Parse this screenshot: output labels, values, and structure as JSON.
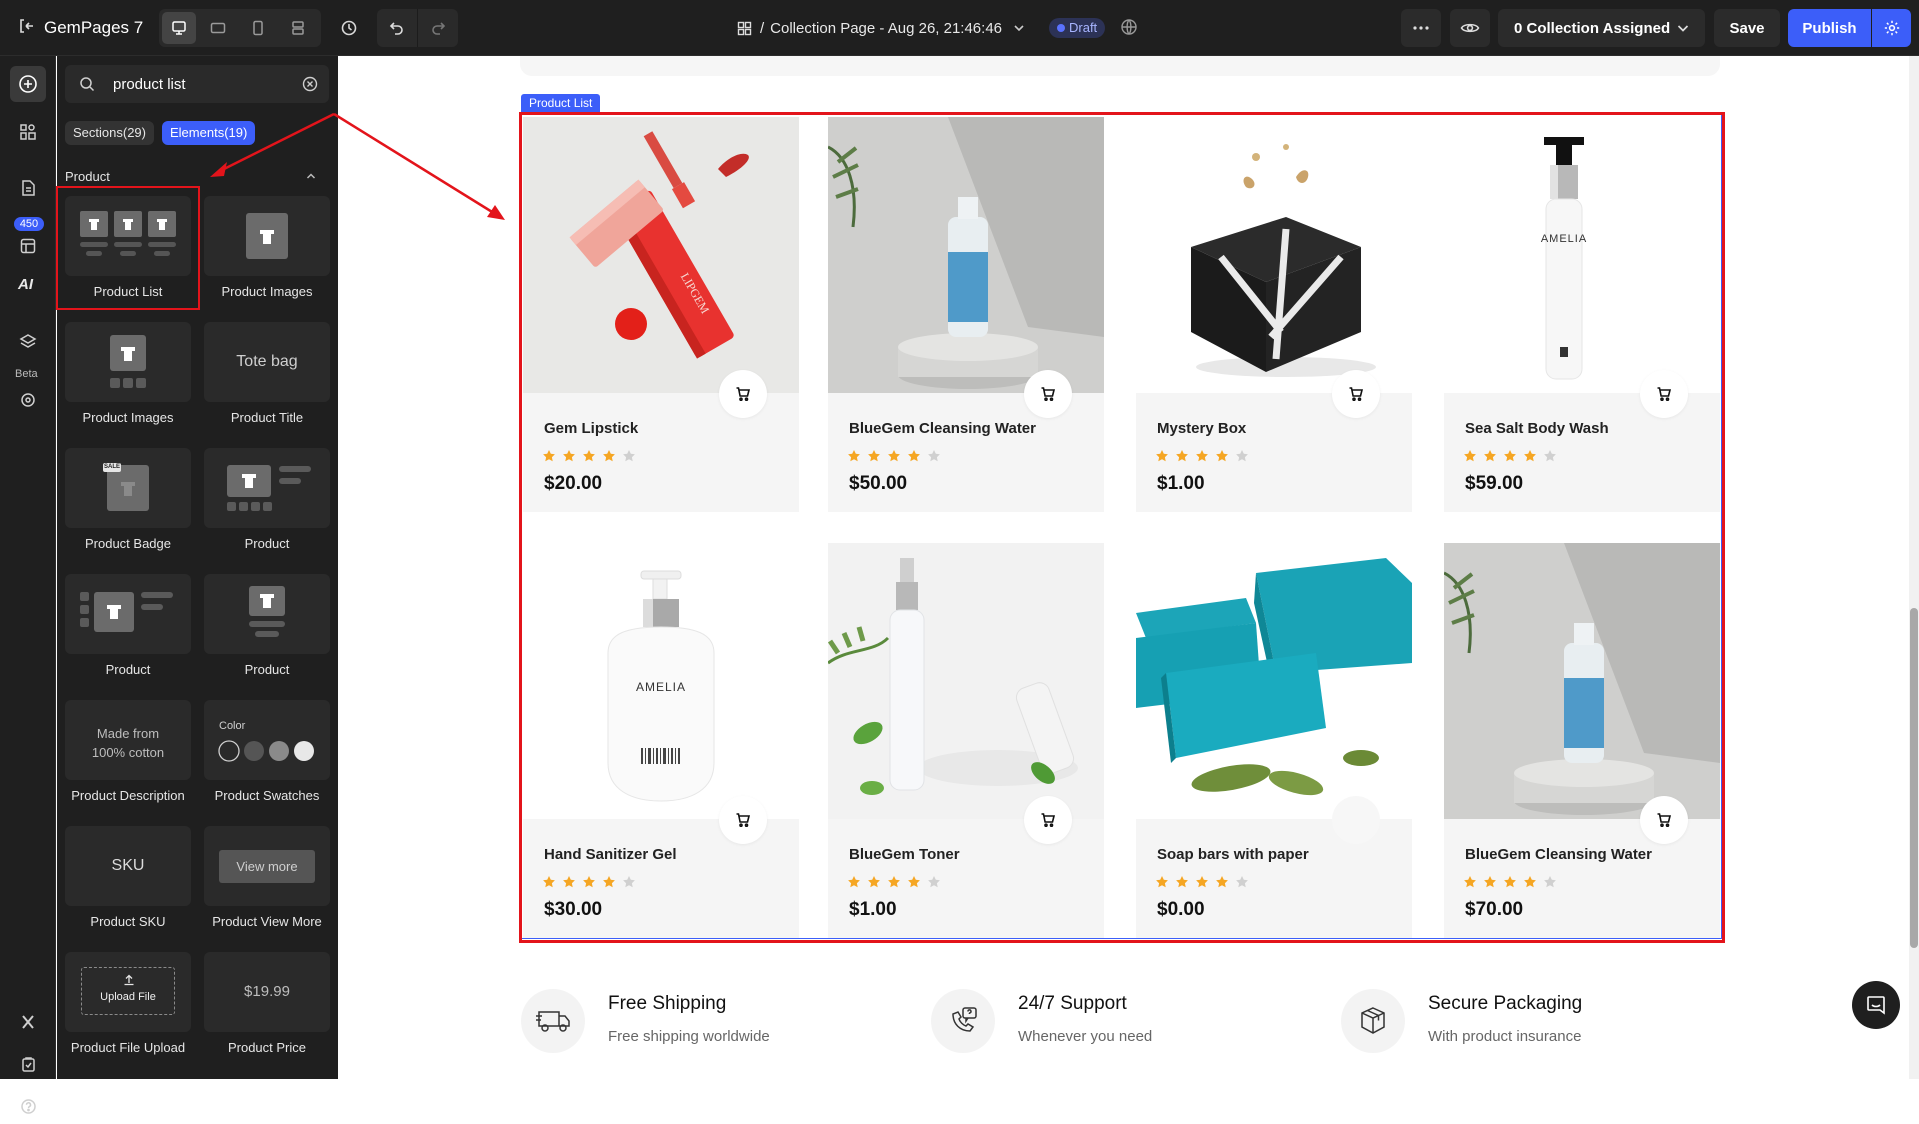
{
  "topbar": {
    "app_name": "GemPages 7",
    "page_title": "Collection Page - Aug 26, 21:46:46",
    "status_badge": "Draft",
    "collection_button": "0 Collection Assigned",
    "save_label": "Save",
    "publish_label": "Publish"
  },
  "rail": {
    "badge": "450",
    "ai_label": "AI",
    "beta_label": "Beta"
  },
  "panel": {
    "search_value": "product list",
    "tabs": [
      {
        "label": "Sections(29)"
      },
      {
        "label": "Elements(19)"
      }
    ],
    "group_title": "Product",
    "elements": [
      {
        "label": "Product List",
        "icon": "product-list-icon"
      },
      {
        "label": "Product Images",
        "icon": "product-image-icon"
      },
      {
        "label": "Product Images",
        "icon": "product-images-gallery-icon"
      },
      {
        "label": "Product Title",
        "icon": "text-preview",
        "preview": "Tote bag"
      },
      {
        "label": "Product Badge",
        "icon": "badge-icon",
        "preview": "SALE"
      },
      {
        "label": "Product",
        "icon": "product-layout-icon"
      },
      {
        "label": "Product",
        "icon": "product-layout-icon"
      },
      {
        "label": "Product",
        "icon": "product-layout-icon"
      },
      {
        "label": "Product Description",
        "icon": "text-preview",
        "preview": "Made from\n100% cotton"
      },
      {
        "label": "Product Swatches",
        "icon": "swatches-icon",
        "preview": "Color"
      },
      {
        "label": "Product SKU",
        "icon": "text-preview",
        "preview": "SKU"
      },
      {
        "label": "Product View More",
        "icon": "button-preview",
        "preview": "View more"
      },
      {
        "label": "Product File Upload",
        "icon": "upload-icon",
        "preview": "Upload File"
      },
      {
        "label": "Product Price",
        "icon": "text-preview",
        "preview": "$19.99"
      }
    ]
  },
  "canvas": {
    "product_list_tag": "Product List",
    "products": [
      {
        "title": "Gem Lipstick",
        "rating": 4,
        "price": "$20.00",
        "image": "lipstick"
      },
      {
        "title": "BlueGem Cleansing Water",
        "rating": 4,
        "price": "$50.00",
        "image": "bottle-blue"
      },
      {
        "title": "Mystery Box",
        "rating": 4,
        "price": "$1.00",
        "image": "mystery-box"
      },
      {
        "title": "Sea Salt Body Wash",
        "rating": 4,
        "price": "$59.00",
        "image": "pump-white"
      },
      {
        "title": "Hand Sanitizer Gel",
        "rating": 4,
        "price": "$30.00",
        "image": "sanitizer"
      },
      {
        "title": "BlueGem Toner",
        "rating": 4,
        "price": "$1.00",
        "image": "toner"
      },
      {
        "title": "Soap bars with paper",
        "rating": 4,
        "price": "$0.00",
        "image": "soap"
      },
      {
        "title": "BlueGem Cleansing Water",
        "rating": 4,
        "price": "$70.00",
        "image": "bottle-blue"
      }
    ],
    "features": [
      {
        "title": "Free Shipping",
        "subtitle": "Free shipping worldwide",
        "icon": "truck-icon"
      },
      {
        "title": "24/7 Support",
        "subtitle": "Whenever you need",
        "icon": "support-phone-icon"
      },
      {
        "title": "Secure Packaging",
        "subtitle": "With product insurance",
        "icon": "package-icon"
      }
    ]
  },
  "colors": {
    "accent": "#3c5ef9",
    "highlight": "#e3141b",
    "star": "#f5a623",
    "star_empty": "#d0d0d0",
    "dark_bg": "#1f1f1f"
  }
}
